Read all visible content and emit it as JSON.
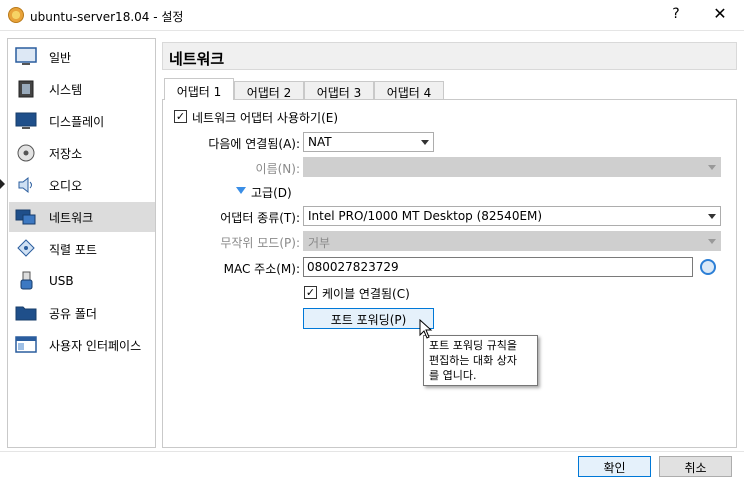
{
  "window": {
    "title": "ubuntu-server18.04 - 설정",
    "help": "?",
    "close": "✕"
  },
  "sidebar": {
    "items": [
      {
        "label": "일반",
        "icon": "general-icon"
      },
      {
        "label": "시스템",
        "icon": "system-icon"
      },
      {
        "label": "디스플레이",
        "icon": "display-icon"
      },
      {
        "label": "저장소",
        "icon": "storage-icon"
      },
      {
        "label": "오디오",
        "icon": "audio-icon"
      },
      {
        "label": "네트워크",
        "icon": "network-icon",
        "selected": true
      },
      {
        "label": "직렬 포트",
        "icon": "serial-port-icon"
      },
      {
        "label": "USB",
        "icon": "usb-icon"
      },
      {
        "label": "공유 폴더",
        "icon": "shared-folder-icon"
      },
      {
        "label": "사용자 인터페이스",
        "icon": "user-interface-icon"
      }
    ]
  },
  "main": {
    "section_title": "네트워크",
    "tabs": [
      {
        "label": "어댑터 1",
        "active": true
      },
      {
        "label": "어댑터 2"
      },
      {
        "label": "어댑터 3"
      },
      {
        "label": "어댑터 4"
      }
    ],
    "enable_adapter": {
      "label": "네트워크 어댑터 사용하기(E)",
      "checked": true
    },
    "attached_to": {
      "label": "다음에 연결됨(A):",
      "value": "NAT"
    },
    "name": {
      "label": "이름(N):",
      "value": ""
    },
    "advanced": {
      "label": "고급(D)"
    },
    "adapter_type": {
      "label": "어댑터 종류(T):",
      "value": "Intel PRO/1000 MT Desktop (82540EM)"
    },
    "promiscuous": {
      "label": "무작위 모드(P):",
      "value": "거부"
    },
    "mac": {
      "label": "MAC 주소(M):",
      "value": "080027823729"
    },
    "cable_connected": {
      "label": "케이블 연결됨(C)",
      "checked": true
    },
    "port_forwarding": {
      "label": "포트 포워딩(P)"
    },
    "tooltip": {
      "lines": [
        "포트 포워딩 규칙을",
        "편집하는 대화 상자",
        "를 엽니다."
      ]
    }
  },
  "footer": {
    "ok_label": "확인",
    "cancel_label": "취소"
  },
  "colors": {
    "accent": "#0078d7",
    "selection": "#dcdcdc",
    "disabled": "#cfcfcf"
  }
}
